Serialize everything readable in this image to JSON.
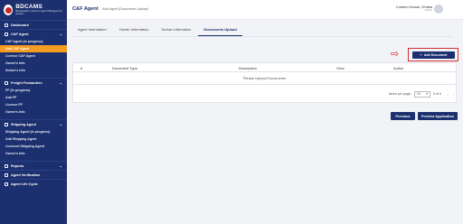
{
  "logo": {
    "title": "BDCAMS",
    "subtitle": "Bangladesh Customs Agent Management System"
  },
  "sidebar": {
    "dashboard": "Dashboard",
    "cf_section": "C&F Agent",
    "cf_items": [
      "C&F Agent (In progress)",
      "Add C&F Agent",
      "Licence C&F Agent",
      "Owner's Info",
      "Sorker's Info"
    ],
    "ff_section": "Freight Forwarders",
    "ff_items": [
      "FF (In progress)",
      "Add FF",
      "Licence FF",
      "Owner's Info"
    ],
    "sa_section": "Shipping Agent",
    "sa_items": [
      "Shipping Agent (In progress)",
      "Add Shipping Agent",
      "Licenced Shipping Agent",
      "Owner's Info"
    ],
    "reports": "Reports",
    "verification": "Agent Verification",
    "lifecycle": "Agent Life Cycle"
  },
  "header": {
    "title": "C&F Agent",
    "subtitle": "Add Agent (Documents Upload)",
    "user_name": "Custom House, Dhaka",
    "user_role": "Admin"
  },
  "tabs": [
    "Agent Information",
    "Owner Information",
    "Sorkar Information",
    "Documents Upload"
  ],
  "add_button": {
    "icon": "+",
    "label": "Add Document"
  },
  "table": {
    "headers": [
      "#",
      "Document Type",
      "Description",
      "View",
      "Action"
    ],
    "empty_message": "Please Upload Documents",
    "pager": {
      "label": "Items per page:",
      "value": "10",
      "range": "0 of 0",
      "prev": "‹",
      "next": "›"
    }
  },
  "buttons": {
    "previous": "Previous",
    "preview": "Preview Application"
  },
  "colors": {
    "primary": "#1c2f6e",
    "active": "#f59c22",
    "annotation": "#d32f2f"
  }
}
